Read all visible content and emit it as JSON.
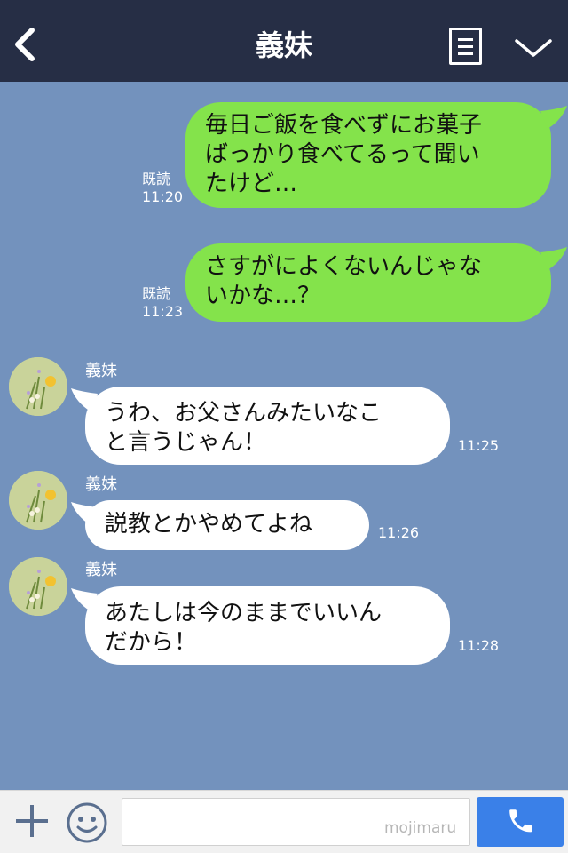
{
  "header": {
    "title": "義妹",
    "back_icon": "chevron-left-icon",
    "menu_icon": "document-menu-icon",
    "collapse_icon": "chevron-down-icon"
  },
  "messages": [
    {
      "direction": "outgoing",
      "lines": [
        "毎日ご飯を食べずにお菓子",
        "ばっかり食べてるって聞い",
        "たけど…"
      ],
      "read_label": "既読",
      "time": "11:20"
    },
    {
      "direction": "outgoing",
      "lines": [
        "さすがによくないんじゃな",
        "いかな…？"
      ],
      "read_label": "既読",
      "time": "11:23"
    },
    {
      "direction": "incoming",
      "sender": "義妹",
      "lines": [
        "うわ、お父さんみたいなこ",
        "と言うじゃん！"
      ],
      "time": "11:25"
    },
    {
      "direction": "incoming",
      "sender": "義妹",
      "lines": [
        "説教とかやめてよね"
      ],
      "time": "11:26"
    },
    {
      "direction": "incoming",
      "sender": "義妹",
      "lines": [
        "あたしは今のままでいいん",
        "だから！"
      ],
      "time": "11:28"
    }
  ],
  "input_bar": {
    "plus_icon": "plus-icon",
    "emoji_icon": "smiley-icon",
    "input_value": "",
    "watermark": "mojimaru",
    "call_icon": "phone-icon"
  },
  "colors": {
    "header_bg": "#262e45",
    "chat_bg": "#7392bd",
    "outgoing_bubble": "#84e34b",
    "incoming_bubble": "#ffffff",
    "call_button": "#3a80e8"
  }
}
